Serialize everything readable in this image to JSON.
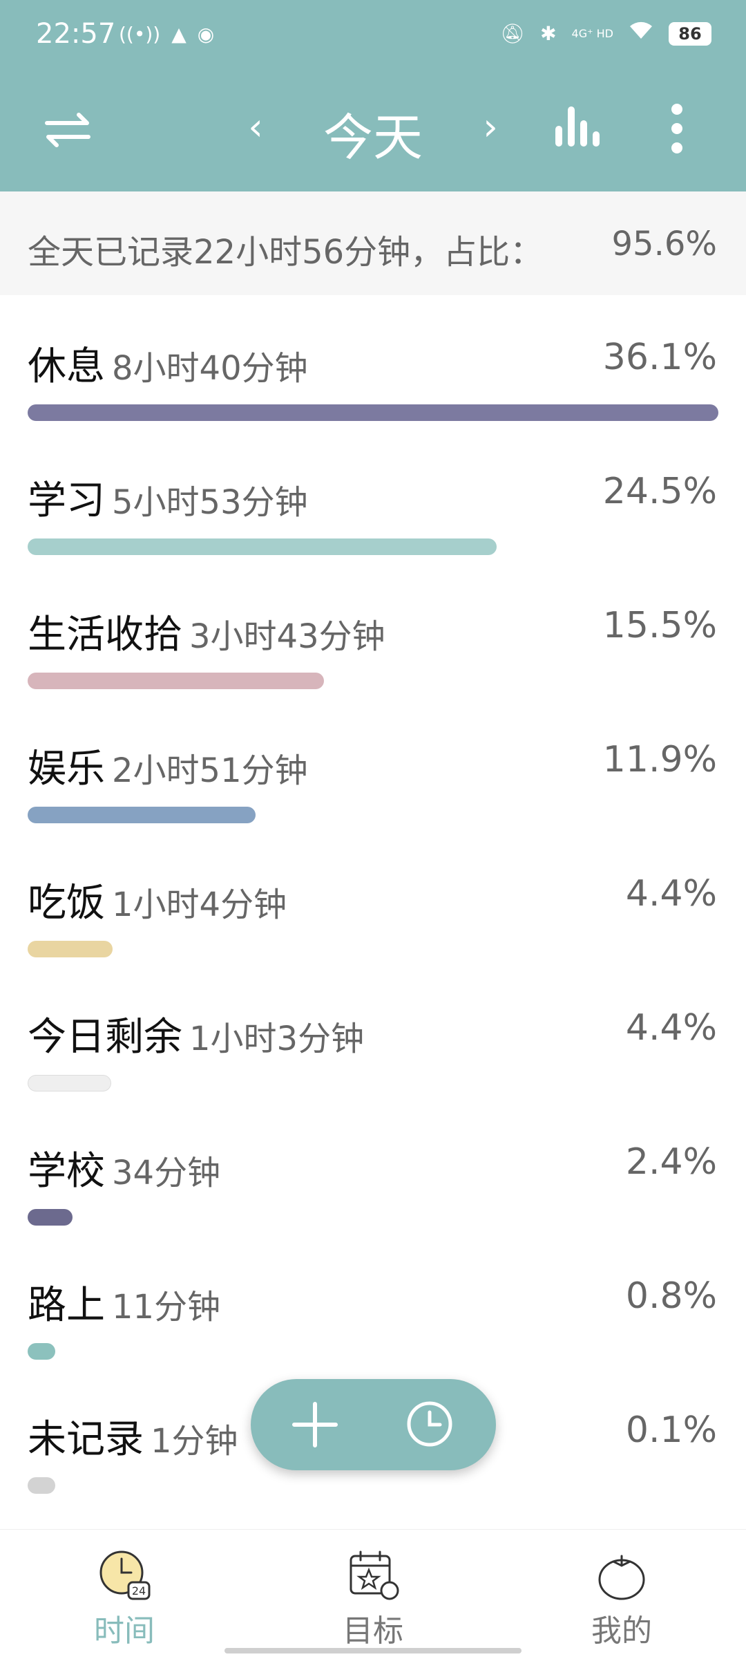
{
  "status_bar": {
    "time": "22:57",
    "battery": "86",
    "network_label": "4G⁺ HD"
  },
  "toolbar": {
    "title": "今天",
    "prev_glyph": "‹",
    "next_glyph": "›"
  },
  "summary": {
    "text": "全天已记录22小时56分钟，占比：",
    "percent": "95.6%"
  },
  "categories": [
    {
      "name": "休息",
      "duration": "8小时40分钟",
      "percent": "36.1%",
      "color": "#7c7aa0",
      "fraction": 1.0
    },
    {
      "name": "学习",
      "duration": "5小时53分钟",
      "percent": "24.5%",
      "color": "#a6cfcc",
      "fraction": 0.679
    },
    {
      "name": "生活收拾",
      "duration": "3小时43分钟",
      "percent": "15.5%",
      "color": "#d7b5bb",
      "fraction": 0.429
    },
    {
      "name": "娱乐",
      "duration": "2小时51分钟",
      "percent": "11.9%",
      "color": "#86a2c2",
      "fraction": 0.33
    },
    {
      "name": "吃饭",
      "duration": "1小时4分钟",
      "percent": "4.4%",
      "color": "#e9d5a1",
      "fraction": 0.123
    },
    {
      "name": "今日剩余",
      "duration": "1小时3分钟",
      "percent": "4.4%",
      "color": "#efefef",
      "fraction": 0.121
    },
    {
      "name": "学校",
      "duration": "34分钟",
      "percent": "2.4%",
      "color": "#6c6a8e",
      "fraction": 0.065
    },
    {
      "name": "路上",
      "duration": "11分钟",
      "percent": "0.8%",
      "color": "#8cc1bd",
      "fraction": 0.04
    },
    {
      "name": "未记录",
      "duration": "1分钟",
      "percent": "0.1%",
      "color": "#d3d3d3",
      "fraction": 0.04
    }
  ],
  "bottom_nav": {
    "items": [
      {
        "label": "时间",
        "icon": "clock-24-icon",
        "active": true
      },
      {
        "label": "目标",
        "icon": "calendar-star-icon",
        "active": false
      },
      {
        "label": "我的",
        "icon": "tomato-icon",
        "active": false
      }
    ]
  },
  "colors": {
    "accent": "#88bcbb",
    "summary_bg": "#f6f6f6"
  }
}
